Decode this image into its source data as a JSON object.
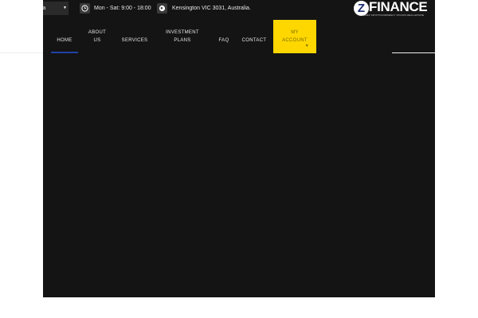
{
  "topbar": {
    "country_text": "ralia",
    "hours_text": "Mon - Sat: 9:00 - 18:00",
    "address_text": "Kensington VIC 3031, Australia.",
    "hours_icon": "clock-icon",
    "address_icon": "globe-icon"
  },
  "logo": {
    "badge": "Z",
    "word": "FINANCE",
    "tagline": "FOREX CRYPTOCURRENCY STOCKS REAL ESTATE"
  },
  "nav": {
    "items": [
      {
        "line1": "HOME",
        "line2": ""
      },
      {
        "line1": "ABOUT",
        "line2": "US"
      },
      {
        "line1": "SERVICES",
        "line2": ""
      },
      {
        "line1": "INVESTMENT",
        "line2": "PLANS"
      },
      {
        "line1": "FAQ",
        "line2": ""
      },
      {
        "line1": "CONTACT",
        "line2": ""
      },
      {
        "line1": "MY",
        "line2": "ACCOUNT"
      }
    ]
  },
  "colors": {
    "background": "#141414",
    "cta": "#ffd700",
    "active_underline": "#2142a6"
  }
}
